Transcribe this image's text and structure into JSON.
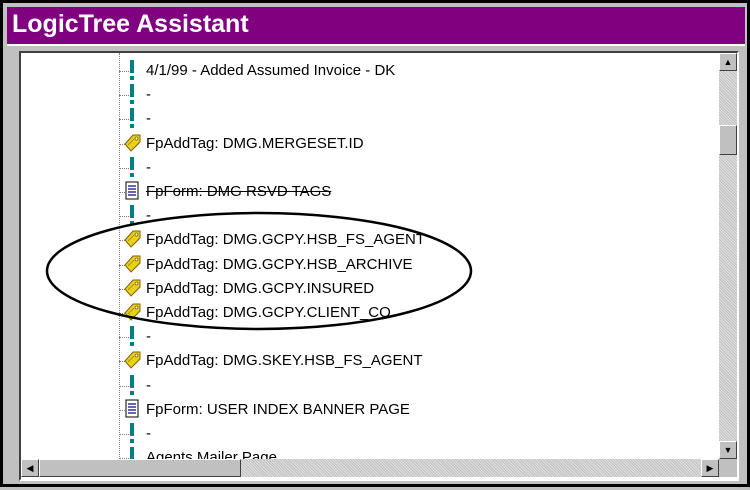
{
  "window": {
    "title": "LogicTree Assistant",
    "title_bar_color": "#800080"
  },
  "tree": {
    "items": [
      {
        "icon": "exclamation-icon",
        "label": "4/1/99 - Added Assumed Invoice - DK"
      },
      {
        "icon": "exclamation-icon",
        "label": "-"
      },
      {
        "icon": "exclamation-icon",
        "label": "-"
      },
      {
        "icon": "tag-icon",
        "label": "FpAddTag: DMG.MERGESET.ID"
      },
      {
        "icon": "exclamation-icon",
        "label": "-"
      },
      {
        "icon": "document-icon",
        "label": "FpForm: DMG RSVD TAGS"
      },
      {
        "icon": "exclamation-icon",
        "label": "-"
      },
      {
        "icon": "tag-icon",
        "label": "FpAddTag: DMG.GCPY.HSB_FS_AGENT"
      },
      {
        "icon": "tag-icon",
        "label": "FpAddTag: DMG.GCPY.HSB_ARCHIVE"
      },
      {
        "icon": "tag-icon",
        "label": "FpAddTag: DMG.GCPY.INSURED"
      },
      {
        "icon": "tag-icon",
        "label": "FpAddTag: DMG.GCPY.CLIENT_CO"
      },
      {
        "icon": "exclamation-icon",
        "label": "-"
      },
      {
        "icon": "tag-icon",
        "label": "FpAddTag: DMG.SKEY.HSB_FS_AGENT"
      },
      {
        "icon": "exclamation-icon",
        "label": "-"
      },
      {
        "icon": "document-icon",
        "label": "FpForm: USER INDEX BANNER PAGE"
      },
      {
        "icon": "exclamation-icon",
        "label": "-"
      },
      {
        "icon": "exclamation-icon",
        "label": "Agents Mailer Page"
      }
    ]
  },
  "scrollbars": {
    "vertical": {
      "up_icon": "arrow-up-icon",
      "down_icon": "arrow-down-icon"
    },
    "horizontal": {
      "left_icon": "arrow-left-icon",
      "right_icon": "arrow-right-icon"
    }
  },
  "colors": {
    "exclamation": "#008080",
    "tag": "#e8d020",
    "document": "#000080"
  }
}
